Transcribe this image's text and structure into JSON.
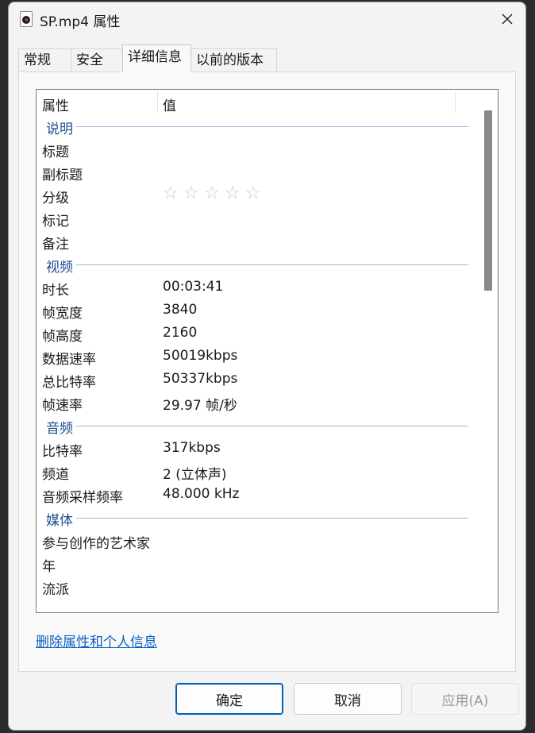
{
  "window": {
    "title": "SP.mp4 属性"
  },
  "tabs": [
    {
      "label": "常规"
    },
    {
      "label": "安全"
    },
    {
      "label": "详细信息"
    },
    {
      "label": "以前的版本"
    }
  ],
  "list": {
    "header_property": "属性",
    "header_value": "值",
    "groups": {
      "description": "说明",
      "video": "视频",
      "audio": "音频",
      "media": "媒体"
    },
    "rows": {
      "title": {
        "name": "标题",
        "value": ""
      },
      "subtitle": {
        "name": "副标题",
        "value": ""
      },
      "rating": {
        "name": "分级",
        "stars_total": 5,
        "stars_filled": 0,
        "star_glyph": "☆"
      },
      "tags": {
        "name": "标记",
        "value": ""
      },
      "comments": {
        "name": "备注",
        "value": ""
      },
      "duration": {
        "name": "时长",
        "value": "00:03:41"
      },
      "frame_width": {
        "name": "帧宽度",
        "value": "3840"
      },
      "frame_height": {
        "name": "帧高度",
        "value": "2160"
      },
      "data_rate": {
        "name": "数据速率",
        "value": "50019kbps"
      },
      "total_bitrate": {
        "name": "总比特率",
        "value": "50337kbps"
      },
      "frame_rate": {
        "name": "帧速率",
        "value": "29.97 帧/秒"
      },
      "bitrate": {
        "name": "比特率",
        "value": "317kbps"
      },
      "channels": {
        "name": "频道",
        "value": "2 (立体声)"
      },
      "sample_rate": {
        "name": "音频采样频率",
        "value": "48.000 kHz"
      },
      "contributing_artists": {
        "name": "参与创作的艺术家",
        "value": ""
      },
      "year": {
        "name": "年",
        "value": ""
      },
      "genre": {
        "name": "流派",
        "value": ""
      }
    }
  },
  "remove_link": "删除属性和个人信息",
  "buttons": {
    "ok": "确定",
    "cancel": "取消",
    "apply": "应用(A)"
  },
  "colors": {
    "group_label": "#1f4c91",
    "link": "#0b61c2",
    "primary_border": "#0060b8"
  }
}
